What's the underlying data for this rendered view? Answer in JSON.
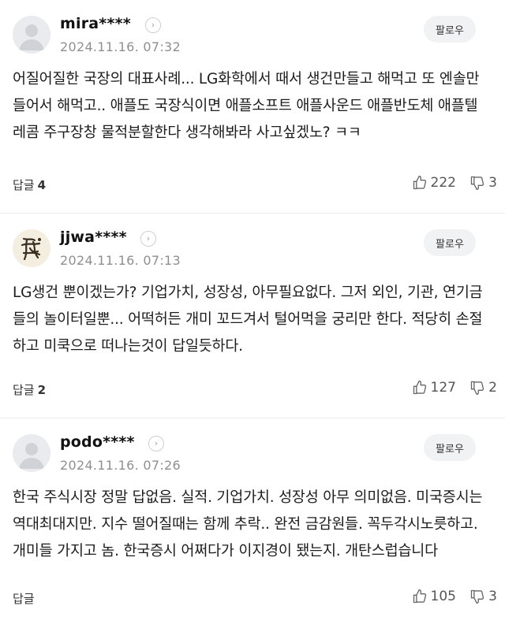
{
  "comments": [
    {
      "username": "mira****",
      "timestamp": "2024.11.16. 07:32",
      "follow_label": "팔로우",
      "body": "어질어질한 국장의 대표사례... LG화학에서 때서 생건만들고 해먹고 또 엔솔만들어서 해먹고.. 애플도 국장식이면 애플소프트 애플사운드 애플반도체 애플텔레콤 주구장창 물적분할한다 생각해봐라 사고싶겠노? ㅋㅋ",
      "reply_label": "답글",
      "reply_count": "4",
      "likes": "222",
      "dislikes": "3",
      "avatar": "default-avatar-icon"
    },
    {
      "username": "jjwa****",
      "timestamp": "2024.11.16. 07:13",
      "follow_label": "팔로우",
      "body": "LG생건 뿐이겠는가? 기업가치, 성장성, 아무필요없다. 그저 외인, 기관, 연기금들의 놀이터일뿐... 어떡허든 개미 꼬드겨서 털어먹을 궁리만 한다. 적당히 손절하고 미쿡으로 떠나는것이 답일듯하다.",
      "reply_label": "답글",
      "reply_count": "2",
      "likes": "127",
      "dislikes": "2",
      "avatar": "calligraphy-avatar"
    },
    {
      "username": "podo****",
      "timestamp": "2024.11.16. 07:26",
      "follow_label": "팔로우",
      "body": "한국 주식시장 정말 답없음. 실적. 기업가치. 성장성 아무 의미없음. 미국증시는 역대최대지만. 지수 떨어질때는 함께 추락.. 완전 금감원들. 꼭두각시노릇하고. 개미들 가지고 놈. 한국증시 어쩌다가 이지경이 됐는지. 개탄스럽습니다",
      "reply_label": "답글",
      "reply_count": "",
      "likes": "105",
      "dislikes": "3",
      "avatar": "default-avatar-icon"
    }
  ]
}
